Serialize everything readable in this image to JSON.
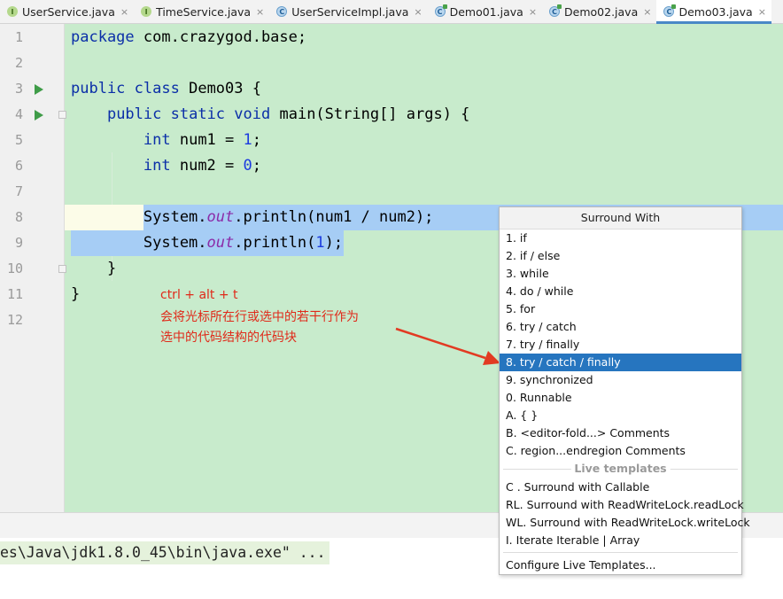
{
  "tabs": [
    {
      "label": "UserService.java",
      "icon": "interface-icon",
      "glyph": "I",
      "kind": "interface",
      "active": false
    },
    {
      "label": "TimeService.java",
      "icon": "interface-icon",
      "glyph": "I",
      "kind": "interface",
      "active": false
    },
    {
      "label": "UserServiceImpl.java",
      "icon": "class-icon",
      "glyph": "C",
      "kind": "class",
      "active": false
    },
    {
      "label": "Demo01.java",
      "icon": "runnable-class-icon",
      "glyph": "C",
      "kind": "class-run",
      "active": false
    },
    {
      "label": "Demo02.java",
      "icon": "runnable-class-icon",
      "glyph": "C",
      "kind": "class-run",
      "active": false
    },
    {
      "label": "Demo03.java",
      "icon": "runnable-class-icon",
      "glyph": "C",
      "kind": "class-run",
      "active": true
    }
  ],
  "tab_close_glyph": "×",
  "editor": {
    "line_numbers": [
      "1",
      "2",
      "3",
      "4",
      "5",
      "6",
      "7",
      "8",
      "9",
      "10",
      "11",
      "12"
    ],
    "lines": [
      {
        "n": "1",
        "parts": [
          {
            "t": "package",
            "c": "kw"
          },
          {
            "t": " com.crazygod.base;"
          }
        ]
      },
      {
        "n": "2",
        "parts": []
      },
      {
        "n": "3",
        "parts": [
          {
            "t": "public",
            "c": "kw"
          },
          {
            "t": " "
          },
          {
            "t": "class",
            "c": "kw"
          },
          {
            "t": " Demo03 {"
          }
        ]
      },
      {
        "n": "4",
        "parts": [
          {
            "t": "    "
          },
          {
            "t": "public",
            "c": "kw"
          },
          {
            "t": " "
          },
          {
            "t": "static",
            "c": "kw"
          },
          {
            "t": " "
          },
          {
            "t": "void",
            "c": "kw"
          },
          {
            "t": " main(String[] args) {"
          }
        ]
      },
      {
        "n": "5",
        "parts": [
          {
            "t": "        "
          },
          {
            "t": "int",
            "c": "kw"
          },
          {
            "t": " num1 = "
          },
          {
            "t": "1",
            "c": "num"
          },
          {
            "t": ";"
          }
        ]
      },
      {
        "n": "6",
        "parts": [
          {
            "t": "        "
          },
          {
            "t": "int",
            "c": "kw"
          },
          {
            "t": " num2 = "
          },
          {
            "t": "0",
            "c": "num"
          },
          {
            "t": ";"
          }
        ]
      },
      {
        "n": "7",
        "parts": []
      },
      {
        "n": "8",
        "parts": [
          {
            "t": "        System."
          },
          {
            "t": "out",
            "c": "field"
          },
          {
            "t": ".println(num1 / num2);"
          }
        ]
      },
      {
        "n": "9",
        "parts": [
          {
            "t": "        System."
          },
          {
            "t": "out",
            "c": "field"
          },
          {
            "t": ".println("
          },
          {
            "t": "1",
            "c": "num"
          },
          {
            "t": ");"
          }
        ]
      },
      {
        "n": "10",
        "parts": [
          {
            "t": "    }"
          }
        ]
      },
      {
        "n": "11",
        "parts": [
          {
            "t": "}"
          }
        ]
      },
      {
        "n": "12",
        "parts": []
      }
    ],
    "run_lines": [
      "3",
      "4"
    ],
    "fold_lines": [
      "4",
      "10"
    ],
    "selected_lines": [
      "8",
      "9"
    ],
    "current_line": "8"
  },
  "annotation": {
    "shortcut": "ctrl + alt + t",
    "line1": "会将光标所在行或选中的若干行作为",
    "line2": "选中的代码结构的代码块"
  },
  "console": {
    "text": "es\\Java\\jdk1.8.0_45\\bin\\java.exe\" ..."
  },
  "popup": {
    "title": "Surround With",
    "items": [
      {
        "label": "1. if",
        "selected": false
      },
      {
        "label": "2. if / else",
        "selected": false
      },
      {
        "label": "3. while",
        "selected": false
      },
      {
        "label": "4. do / while",
        "selected": false
      },
      {
        "label": "5. for",
        "selected": false
      },
      {
        "label": "6. try / catch",
        "selected": false
      },
      {
        "label": "7. try / finally",
        "selected": false
      },
      {
        "label": "8. try / catch / finally",
        "selected": true
      },
      {
        "label": "9. synchronized",
        "selected": false
      },
      {
        "label": "0. Runnable",
        "selected": false
      },
      {
        "label": "A. { }",
        "selected": false
      },
      {
        "label": "B. <editor-fold...> Comments",
        "selected": false
      },
      {
        "label": "C. region...endregion Comments",
        "selected": false
      }
    ],
    "live_templates_header": "Live templates",
    "live_templates": [
      {
        "label": "C . Surround with Callable"
      },
      {
        "label": "RL. Surround with ReadWriteLock.readLock"
      },
      {
        "label": "WL. Surround with ReadWriteLock.writeLock"
      },
      {
        "label": "I. Iterate Iterable | Array"
      }
    ],
    "configure": "Configure Live Templates..."
  },
  "colors": {
    "editor_bg": "#c8ebcc",
    "selection": "#a6cdf5",
    "popup_selected": "#2675bf",
    "keyword": "#0b2fa8",
    "number": "#1b3ae0",
    "annotation": "#e02a1a",
    "run_arrow": "#3f9c48"
  }
}
